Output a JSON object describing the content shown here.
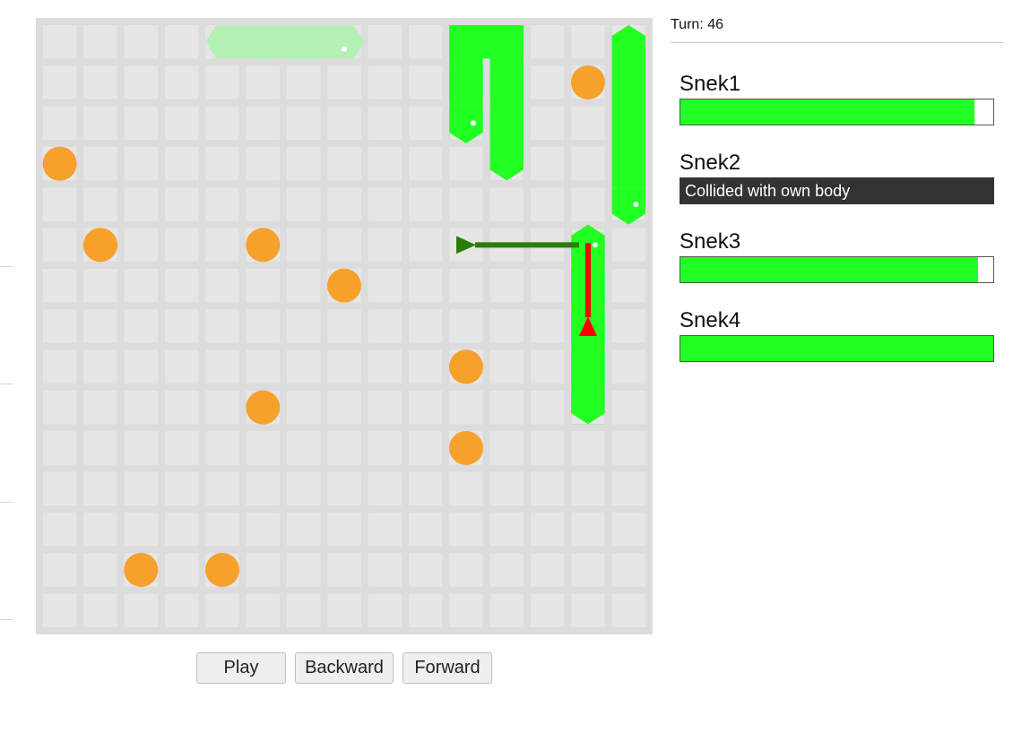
{
  "board": {
    "columns": 15,
    "rows": 15,
    "colors": {
      "background": "#dcdcdc",
      "cell": "#e6e6e6",
      "food": "#f6a12a",
      "snake": "#22ff22",
      "ghost": "#b5f0b5",
      "move_arrow": "#2a7d00",
      "alt_arrow": "#ff0000"
    },
    "food": [
      [
        13,
        1
      ],
      [
        0,
        3
      ],
      [
        1,
        5
      ],
      [
        5,
        5
      ],
      [
        7,
        6
      ],
      [
        10,
        8
      ],
      [
        5,
        9
      ],
      [
        10,
        10
      ],
      [
        2,
        13
      ],
      [
        4,
        13
      ]
    ],
    "snakes": [
      {
        "id": "snek1",
        "color": "#22ff22",
        "body": [
          [
            10,
            2
          ],
          [
            10,
            1
          ],
          [
            10,
            0
          ],
          [
            11,
            0
          ],
          [
            11,
            1
          ],
          [
            11,
            2
          ],
          [
            11,
            3
          ]
        ]
      },
      {
        "id": "snek2",
        "color": "#b5f0b5",
        "dead": true,
        "body": [
          [
            7,
            0
          ],
          [
            6,
            0
          ],
          [
            5,
            0
          ],
          [
            4,
            0
          ]
        ]
      },
      {
        "id": "snek3",
        "color": "#22ff22",
        "body": [
          [
            14,
            4
          ],
          [
            14,
            3
          ],
          [
            14,
            2
          ],
          [
            14,
            1
          ],
          [
            14,
            0
          ]
        ]
      },
      {
        "id": "snek4",
        "color": "#22ff22",
        "body": [
          [
            13,
            5
          ],
          [
            13,
            6
          ],
          [
            13,
            7
          ],
          [
            13,
            8
          ],
          [
            13,
            9
          ]
        ]
      }
    ],
    "arrows": [
      {
        "id": "move-arrow",
        "color": "#2a7d00",
        "from": [
          13,
          5
        ],
        "to": [
          10,
          5
        ]
      },
      {
        "id": "alt-move-arrow",
        "color": "#ff0000",
        "from": [
          13,
          5
        ],
        "to": [
          13,
          7
        ]
      }
    ]
  },
  "controls": {
    "play_label": "Play",
    "backward_label": "Backward",
    "forward_label": "Forward"
  },
  "status": {
    "turn_text": "Turn: 46"
  },
  "snakes_panel": [
    {
      "name": "Snek1",
      "alive": true,
      "health": 94
    },
    {
      "name": "Snek2",
      "alive": false,
      "death_text": "Collided with own body"
    },
    {
      "name": "Snek3",
      "alive": true,
      "health": 95
    },
    {
      "name": "Snek4",
      "alive": true,
      "health": 100
    }
  ]
}
